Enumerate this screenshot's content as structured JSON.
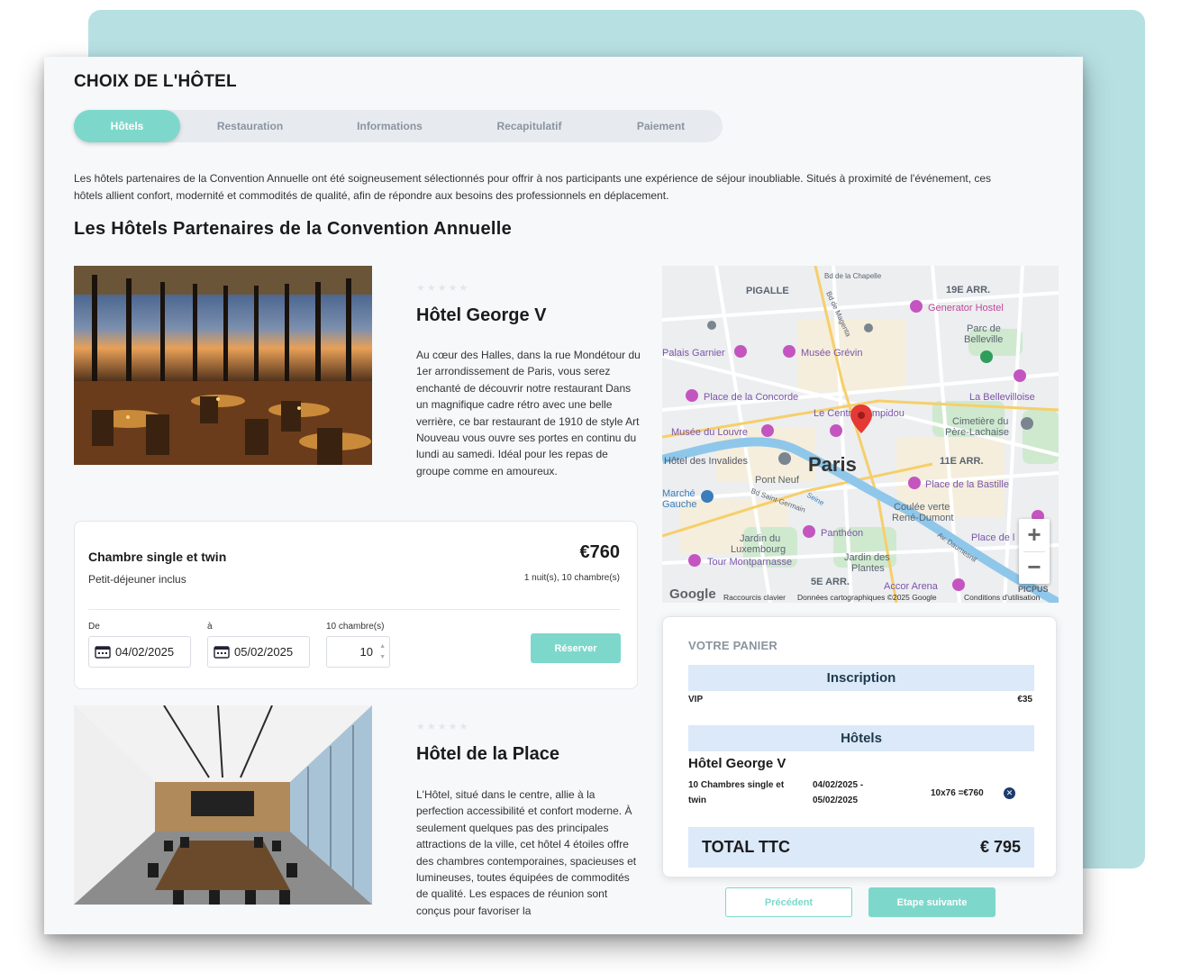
{
  "page": {
    "title": "CHOIX DE L'HÔTEL"
  },
  "tabs": [
    {
      "label": "Hôtels",
      "active": true
    },
    {
      "label": "Restauration",
      "active": false
    },
    {
      "label": "Informations",
      "active": false
    },
    {
      "label": "Recapitulatif",
      "active": false
    },
    {
      "label": "Paiement",
      "active": false
    }
  ],
  "intro": "Les hôtels partenaires de la Convention Annuelle ont été soigneusement sélectionnés pour offrir à nos participants une expérience de séjour inoubliable. Situés à proximité de l'événement, ces hôtels allient confort, modernité et commodités de qualité, afin de répondre aux besoins des professionnels en déplacement.",
  "section_title": "Les Hôtels Partenaires de la Convention Annuelle",
  "hotels": [
    {
      "name": "Hôtel George V",
      "stars": "★★★★★",
      "description": "Au cœur des Halles, dans la rue Mondétour du 1er arrondissement de Paris, vous serez enchanté de découvrir notre restaurant  Dans un magnifique cadre rétro avec une belle verrière, ce bar restaurant de 1910 de style Art Nouveau vous ouvre ses portes en continu du lundi au samedi. Idéal pour les repas de groupe comme en amoureux."
    },
    {
      "name": "Hôtel de la Place",
      "stars": "★★★★★",
      "description": "L'Hôtel, situé dans le centre, allie à la perfection accessibilité et confort moderne. À seulement quelques pas des principales attractions de la ville, cet hôtel 4 étoiles offre des chambres contemporaines, spacieuses et lumineuses, toutes équipées de commodités de qualité. Les espaces de réunion sont conçus pour favoriser la"
    }
  ],
  "room": {
    "name": "Chambre single et twin",
    "subtitle": "Petit-déjeuner inclus",
    "price": "€760",
    "meta": "1 nuit(s), 10 chambre(s)",
    "from_label": "De",
    "from_value": "04/02/2025",
    "to_label": "à",
    "to_value": "05/02/2025",
    "qty_label": "10 chambre(s)",
    "qty_value": "10",
    "reserve_label": "Réserver"
  },
  "map": {
    "city_label": "Paris",
    "labels": {
      "pigalle": "PIGALLE",
      "arr19": "19E ARR.",
      "chapelle": "Bd de la Chapelle",
      "generator": "Generator Hostel",
      "parc": "Parc de",
      "belleville": "Belleville",
      "garnier": "Palais Garnier",
      "grevin": "Musée Grévin",
      "concorde": "Place de la Concorde",
      "labelleville": "La Bellevilloise",
      "centre": "Le Centre Pompidou",
      "cimetiere": "Cimetière du",
      "pere": "Père-Lachaise",
      "louvre": "Musée du Louvre",
      "invalides": "Hôtel des Invalides",
      "arr11": "11E ARR.",
      "pontneuf": "Pont Neuf",
      "bastille": "Place de la Bastille",
      "marche": "Marché",
      "gauche": "Gauche",
      "coulee": "Coulée verte",
      "dumont": "René-Dumont",
      "pantheon": "Panthéon",
      "jardin": "Jardin du",
      "luxembourg": "Luxembourg",
      "montparnasse": "Tour Montparnasse",
      "jardindes": "Jardin des",
      "plantes": "Plantes",
      "arr5": "5E ARR.",
      "accor": "Accor Arena",
      "placede": "Place de l",
      "picpus": "PICPUS",
      "magenta": "Bd de Magenta",
      "stgermain": "Bd Saint-Germain",
      "seine": "Seine",
      "daumesnil": "Av. Daumesnil"
    },
    "footer": {
      "google": "Google",
      "shortcuts": "Raccourcis clavier",
      "data": "Données cartographiques ©2025 Google",
      "terms": "Conditions d'utilisation"
    }
  },
  "cart": {
    "title": "VOTRE PANIER",
    "inscription_header": "Inscription",
    "inscription_item": "VIP",
    "inscription_price": "€35",
    "hotels_header": "Hôtels",
    "hotel_name": "Hôtel George V",
    "room_line1": "10 Chambres single et",
    "room_line2": "twin",
    "dates_line1": "04/02/2025 -",
    "dates_line2": "05/02/2025",
    "calc": "10x76 =€760",
    "total_label": "TOTAL TTC",
    "total_value": "€ 795"
  },
  "nav": {
    "prev": "Précédent",
    "next": "Etape suivante"
  },
  "colors": {
    "accent": "#7dd8cb",
    "backdrop": "#b7e0e3",
    "cart_header": "#dbe9f9"
  }
}
